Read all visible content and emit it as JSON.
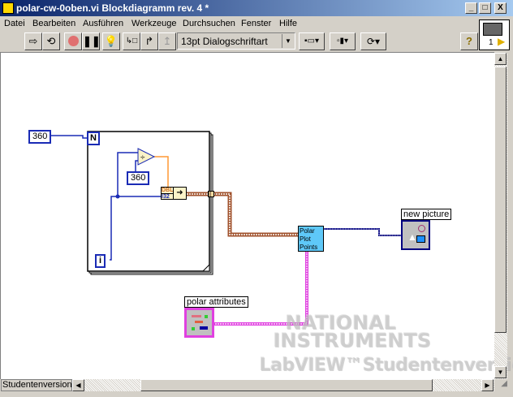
{
  "window": {
    "title": "polar-cw-0oben.vi Blockdiagramm rev. 4 *",
    "minimize": "_",
    "maximize": "□",
    "close": "X"
  },
  "menu": [
    "Datei",
    "Bearbeiten",
    "Ausführen",
    "Werkzeuge",
    "Durchsuchen",
    "Fenster",
    "Hilfe"
  ],
  "toolbar": {
    "font": "13pt Dialogschriftart",
    "help": "?",
    "icons": [
      "run-arrow",
      "run-continuous",
      "abort",
      "pause",
      "highlight-execution",
      "step-into",
      "step-over",
      "step-out",
      "align",
      "distribute",
      "reorder",
      "context-help"
    ]
  },
  "connector_pane": {
    "number": "1"
  },
  "diagram": {
    "count_constant": "360",
    "loop_count": "N",
    "loop_index": "i",
    "divisor_constant": "360",
    "divide": "÷",
    "convert_top": "DBL",
    "convert_bottom": "I32",
    "tunnel": "[]",
    "subvi": [
      "Polar",
      "Plot",
      "Points"
    ],
    "polar_attributes_label": "polar attributes",
    "new_picture_label": "new picture",
    "colors": {
      "wire_int": "#1a2bb5",
      "wire_dbl": "#ff9933",
      "wire_array": "#a0522d",
      "wire_cluster": "#e040e0",
      "wire_picture": "#000080",
      "subvi_bg": "#5ec8f8"
    }
  },
  "watermark": {
    "line1": "NATIONAL",
    "line2": "INSTRUMENTS",
    "line3": "LabVIEW™Studentenversion"
  },
  "statusbar": {
    "label": "Studentenversion"
  }
}
